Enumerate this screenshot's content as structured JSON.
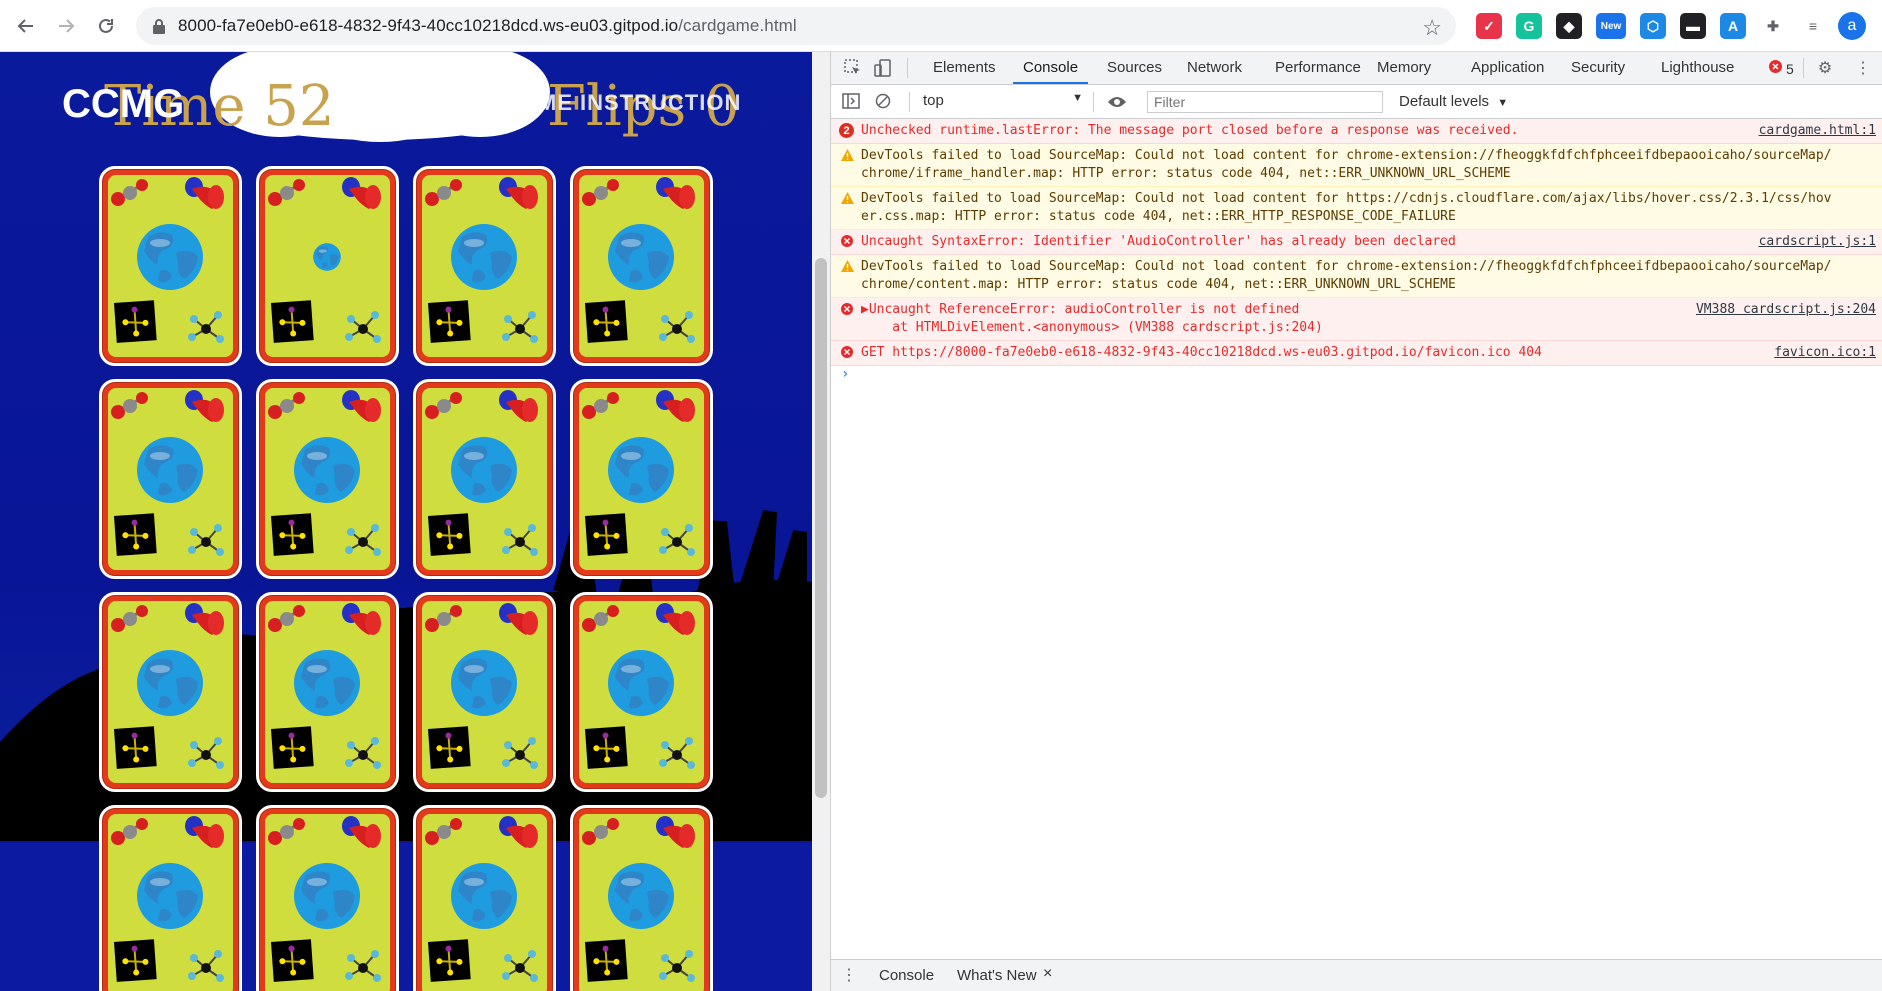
{
  "browser": {
    "url_host": "8000-fa7e0eb0-e618-4832-9f43-40cc10218dcd.ws-eu03.gitpod.io",
    "url_path": "/cardgame.html",
    "extensions": [
      {
        "icon": "pocket-icon",
        "color": "#e8334a",
        "label": "✓"
      },
      {
        "icon": "grammarly-icon",
        "color": "#15c39a",
        "label": "G"
      },
      {
        "icon": "box-icon",
        "color": "#202124",
        "label": "◆"
      },
      {
        "icon": "new-extension-icon",
        "color": "#1a73e8",
        "label": "New"
      },
      {
        "icon": "hex-icon",
        "color": "#1e88e5",
        "label": "⬡"
      },
      {
        "icon": "terminal-icon",
        "color": "#202124",
        "label": "▬"
      },
      {
        "icon": "text-ext-icon",
        "color": "#1e88e5",
        "label": "A"
      },
      {
        "icon": "extensions-puzzle-icon",
        "color": "#5f6368",
        "label": "✚"
      },
      {
        "icon": "reading-list-icon",
        "color": "#5f6368",
        "label": "≡"
      }
    ],
    "avatar_letter": "a"
  },
  "game": {
    "brand": "CCMG",
    "time_label": "Time 52",
    "instruction": "INSTRUCTION",
    "menu_fragment": "ME",
    "flips_label": "Flips 0",
    "card_count": 16
  },
  "devtools": {
    "tabs": [
      "Elements",
      "Console",
      "Sources",
      "Network",
      "Performance",
      "Memory",
      "Application",
      "Security",
      "Lighthouse"
    ],
    "active_tab": "Console",
    "error_count": "5",
    "context": "top",
    "filter_placeholder": "Filter",
    "levels": "Default levels",
    "messages": [
      {
        "type": "error",
        "badge": "2",
        "text": "Unchecked runtime.lastError: The message port closed before a response was received.",
        "source": "cardgame.html:1"
      },
      {
        "type": "warning",
        "text": "DevTools failed to load SourceMap: Could not load content for chrome-extension://fheoggkfdfchfphceeifdbepaooicaho/sourceMap/",
        "text2": "chrome/iframe_handler.map: HTTP error: status code 404, net::ERR_UNKNOWN_URL_SCHEME",
        "source": ""
      },
      {
        "type": "warning",
        "text": "DevTools failed to load SourceMap: Could not load content for https://cdnjs.cloudflare.com/ajax/libs/hover.css/2.3.1/css/hov",
        "text2": "er.css.map: HTTP error: status code 404, net::ERR_HTTP_RESPONSE_CODE_FAILURE",
        "source": ""
      },
      {
        "type": "error",
        "text": "Uncaught SyntaxError: Identifier 'AudioController' has already been declared",
        "source": "cardscript.js:1"
      },
      {
        "type": "warning",
        "text": "DevTools failed to load SourceMap: Could not load content for chrome-extension://fheoggkfdfchfphceeifdbepaooicaho/sourceMap/",
        "text2": "chrome/content.map: HTTP error: status code 404, net::ERR_UNKNOWN_URL_SCHEME",
        "source": ""
      },
      {
        "type": "error",
        "text": "▶Uncaught ReferenceError: audioController is not defined",
        "text2": "    at HTMLDivElement.<anonymous> (VM388 cardscript.js:204)",
        "source": "VM388 cardscript.js:204"
      },
      {
        "type": "error",
        "text": "GET https://8000-fa7e0eb0-e618-4832-9f43-40cc10218dcd.ws-eu03.gitpod.io/favicon.ico 404",
        "source": "favicon.ico:1"
      }
    ],
    "prompt": "›",
    "drawer_tabs": [
      "Console",
      "What's New"
    ],
    "drawer_close": "×"
  },
  "colors": {
    "card_border": "#e33a1b",
    "card_face": "#cfde3e",
    "game_bg": "#0a1a9c",
    "title_gold": "#c8a24e"
  }
}
